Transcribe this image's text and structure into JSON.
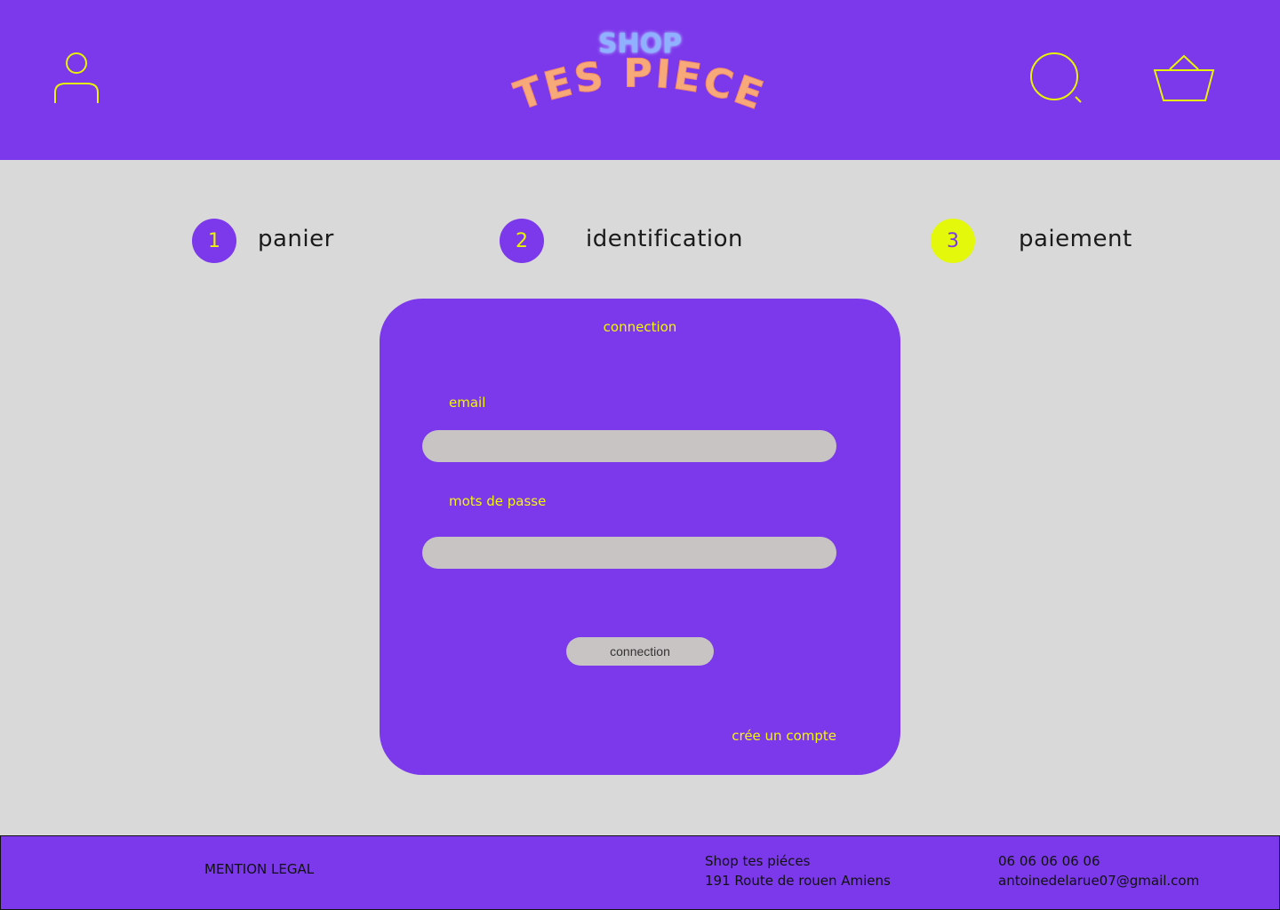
{
  "header": {
    "logo": {
      "top_text": "SHOP",
      "main_text": "TES PIECE"
    },
    "icons": {
      "user": "user-icon",
      "search": "search-icon",
      "cart": "basket-icon"
    },
    "colors": {
      "accent": "#7c38eb",
      "icon": "#e7f500",
      "logo_main": "#f7a97a",
      "logo_top": "#8fb1ff"
    }
  },
  "steps": [
    {
      "number": "1",
      "label": "panier"
    },
    {
      "number": "2",
      "label": "identification"
    },
    {
      "number": "3",
      "label": "paiement"
    }
  ],
  "login": {
    "title": "connection",
    "email_label": "email",
    "email_value": "",
    "password_label": "mots de passe",
    "password_value": "",
    "submit_label": "connection",
    "create_account_label": "crée un compte"
  },
  "footer": {
    "legal": "MENTION LEGAL",
    "shop_name": "Shop tes piéces",
    "address": "191 Route de rouen Amiens",
    "phone": "06 06 06 06 06",
    "email": "antoinedelarue07@gmail.com"
  }
}
